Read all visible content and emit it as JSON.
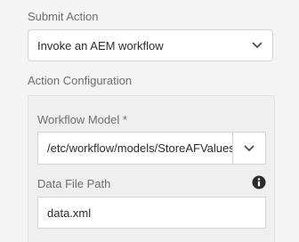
{
  "submit_action": {
    "label": "Submit Action",
    "selected": "Invoke an AEM workflow"
  },
  "action_configuration": {
    "label": "Action Configuration",
    "workflow_model": {
      "label": "Workflow Model *",
      "value": "/etc/workflow/models/StoreAFValues"
    },
    "data_file_path": {
      "label": "Data File Path",
      "value": "data.xml",
      "info_icon": "info-icon"
    }
  },
  "icons": {
    "dropdown": "chevron-down-icon",
    "info": "info-icon"
  }
}
